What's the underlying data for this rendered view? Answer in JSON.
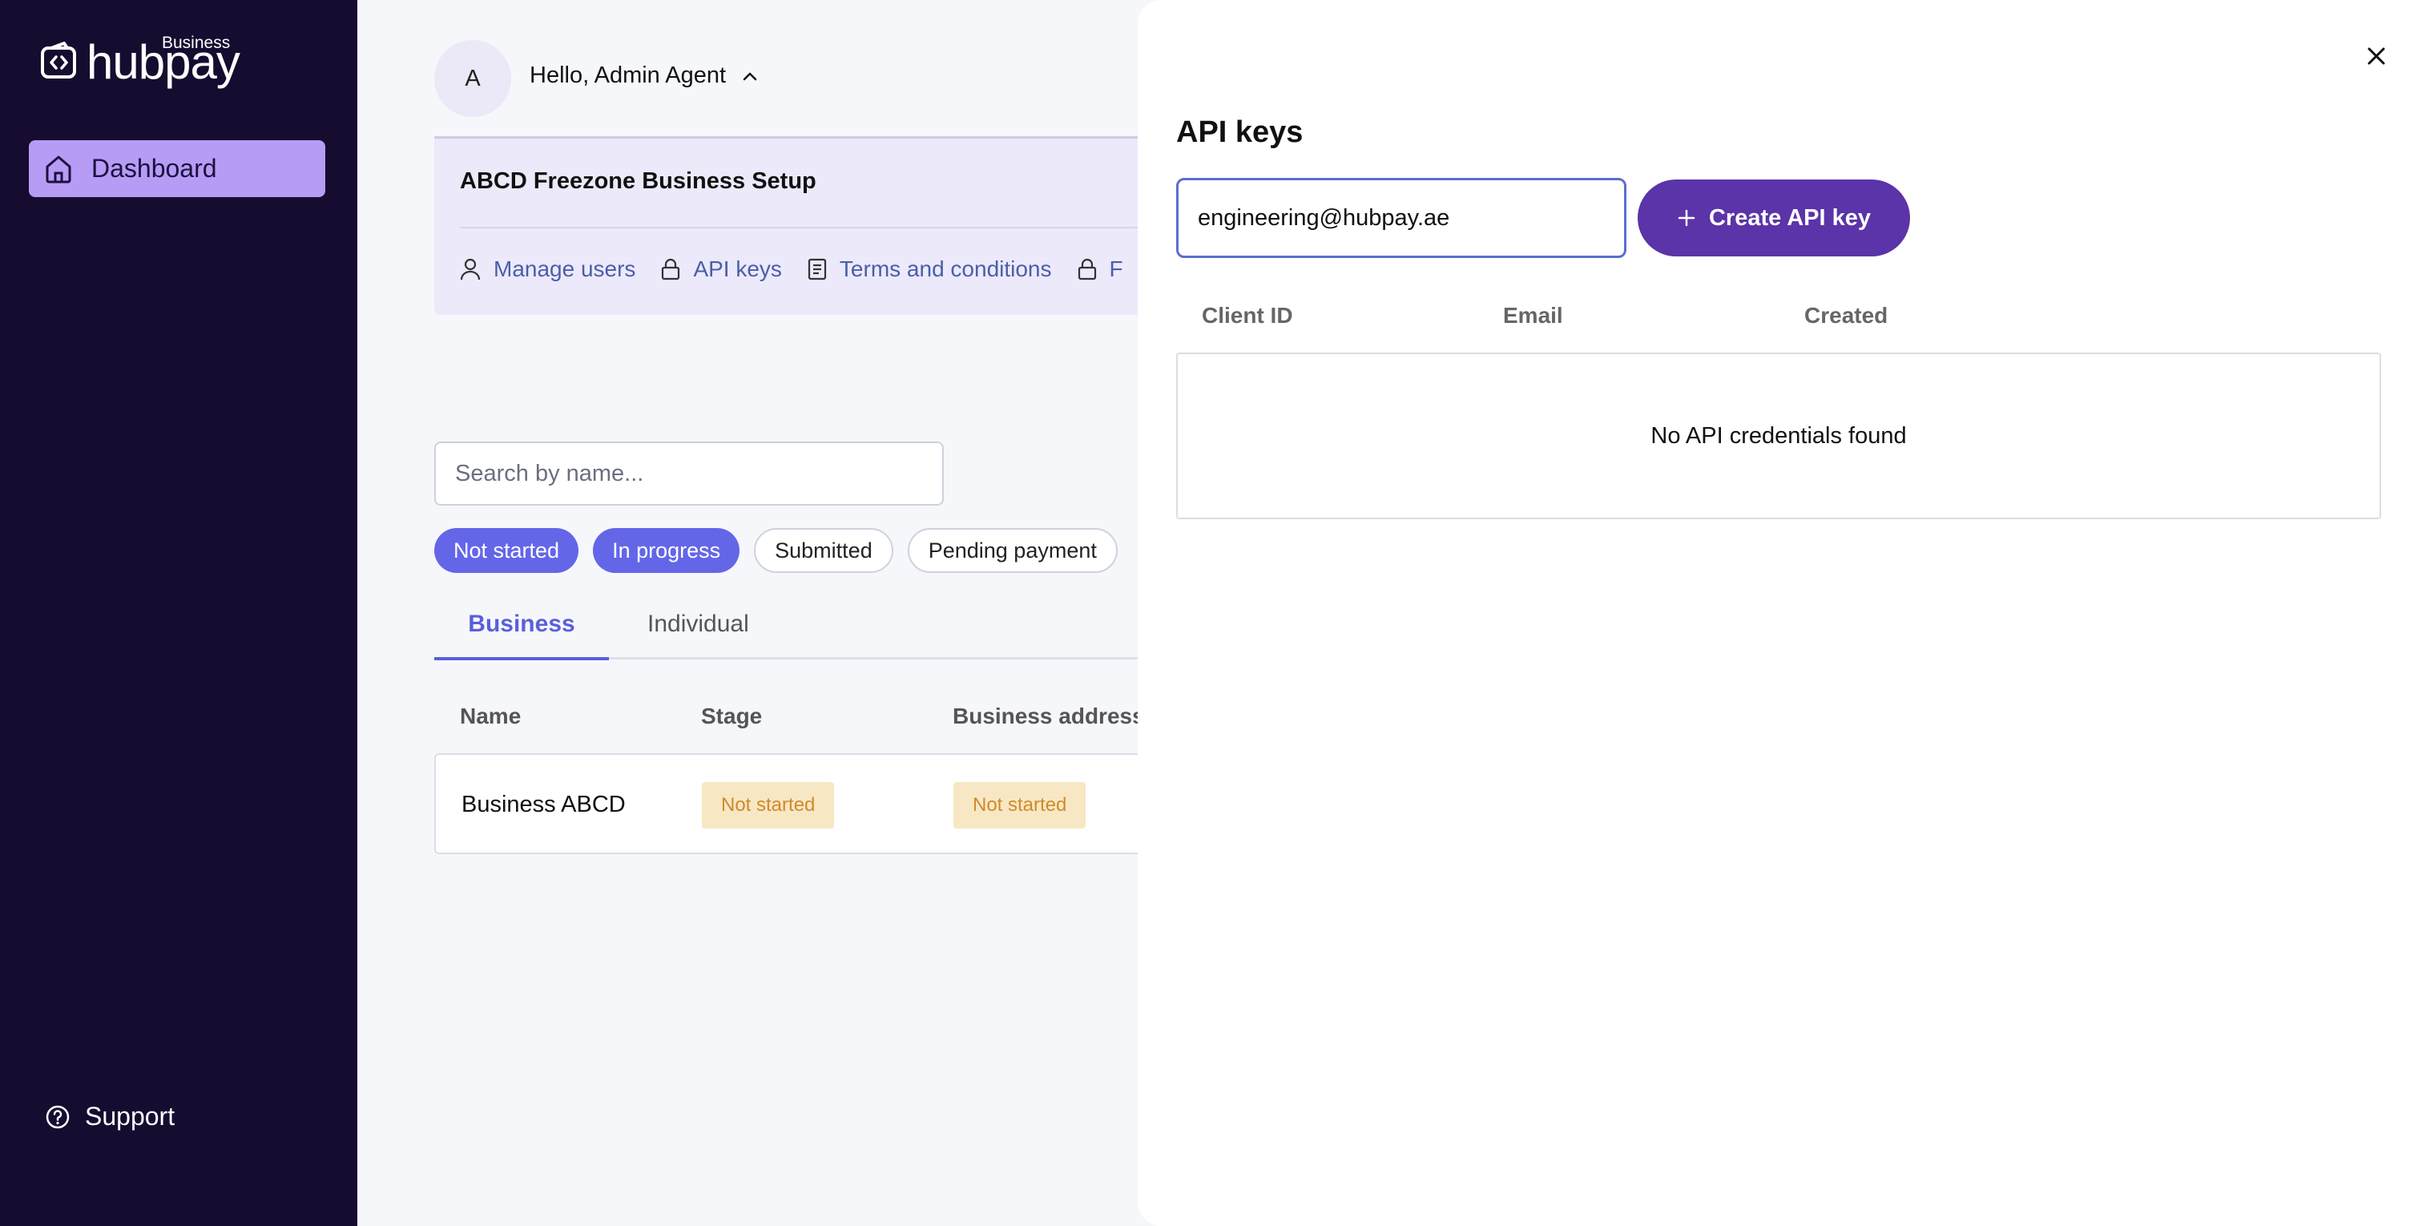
{
  "brand": {
    "name": "hubpay",
    "tag": "Business"
  },
  "sidebar": {
    "items": [
      {
        "label": "Dashboard",
        "icon": "home-icon",
        "active": true
      }
    ],
    "support_label": "Support"
  },
  "header": {
    "avatar_initial": "A",
    "greeting": "Hello, Admin Agent"
  },
  "business_card": {
    "title": "ABCD Freezone Business Setup",
    "links": [
      {
        "label": "Manage users",
        "icon": "user-icon"
      },
      {
        "label": "API keys",
        "icon": "lock-icon"
      },
      {
        "label": "Terms and conditions",
        "icon": "document-icon"
      },
      {
        "label": "F",
        "icon": "lock-icon"
      }
    ]
  },
  "search": {
    "placeholder": "Search by name..."
  },
  "filters": [
    {
      "label": "Not started",
      "active": true
    },
    {
      "label": "In progress",
      "active": true
    },
    {
      "label": "Submitted",
      "active": false
    },
    {
      "label": "Pending payment",
      "active": false
    }
  ],
  "tabs": [
    {
      "label": "Business",
      "active": true
    },
    {
      "label": "Individual",
      "active": false
    }
  ],
  "table": {
    "columns": [
      "Name",
      "Stage",
      "Business address"
    ],
    "rows": [
      {
        "name": "Business ABCD",
        "stage": "Not started",
        "address": "Not started"
      }
    ]
  },
  "drawer": {
    "title": "API keys",
    "email_value": "engineering@hubpay.ae",
    "create_label": "Create API key",
    "columns": [
      "Client ID",
      "Email",
      "Created"
    ],
    "empty_text": "No API credentials found"
  },
  "colors": {
    "sidebar_bg": "#160c30",
    "nav_active": "#b79cf5",
    "chip_active": "#6466e8",
    "primary_button": "#5a34a8",
    "link": "#4a5fa7",
    "badge_bg": "#f8e7c4",
    "badge_text": "#d08a2a"
  }
}
